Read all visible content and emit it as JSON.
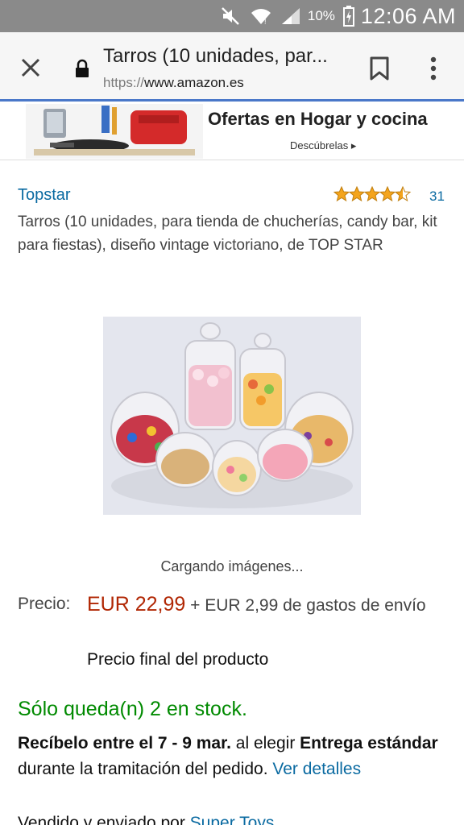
{
  "status_bar": {
    "battery_percent": "10%",
    "time": "12:06 AM",
    "icons": [
      "mute-icon",
      "wifi-icon",
      "signal-icon",
      "battery-charging-icon"
    ]
  },
  "browser": {
    "title": "Tarros (10 unidades, par...",
    "url_protocol": "https://",
    "url_host": "www.amazon.es",
    "accent_color": "#4a78c9",
    "icons": [
      "close-icon",
      "lock-icon",
      "bookmark-icon",
      "more-vert-icon"
    ]
  },
  "banner": {
    "title": "Ofertas en Hogar y cocina",
    "link": "Descúbrelas ▸"
  },
  "product": {
    "brand": "Topstar",
    "rating": 4.5,
    "review_count": "31",
    "title": "Tarros (10 unidades, para tienda de chucherías, candy bar, kit para fiestas), diseño vintage victoriano, de TOP STAR",
    "loading_text": "Cargando imágenes..."
  },
  "price": {
    "label": "Precio:",
    "value": "EUR 22,99",
    "shipping": "+ EUR 2,99 de gastos de envío",
    "final_note": "Precio final del producto",
    "price_color": "#b12704"
  },
  "stock": {
    "text": "Sólo queda(n) 2 en stock.",
    "color": "#008a00"
  },
  "delivery": {
    "part1": "Recíbelo entre el 7 - 9 mar.",
    "part2": " al elegir ",
    "part3": "Entrega estándar",
    "part4": " durante la tramitación del pedido. ",
    "link": "Ver detalles"
  },
  "seller": {
    "prefix": "Vendido y enviado por ",
    "name": "Super Toys"
  }
}
